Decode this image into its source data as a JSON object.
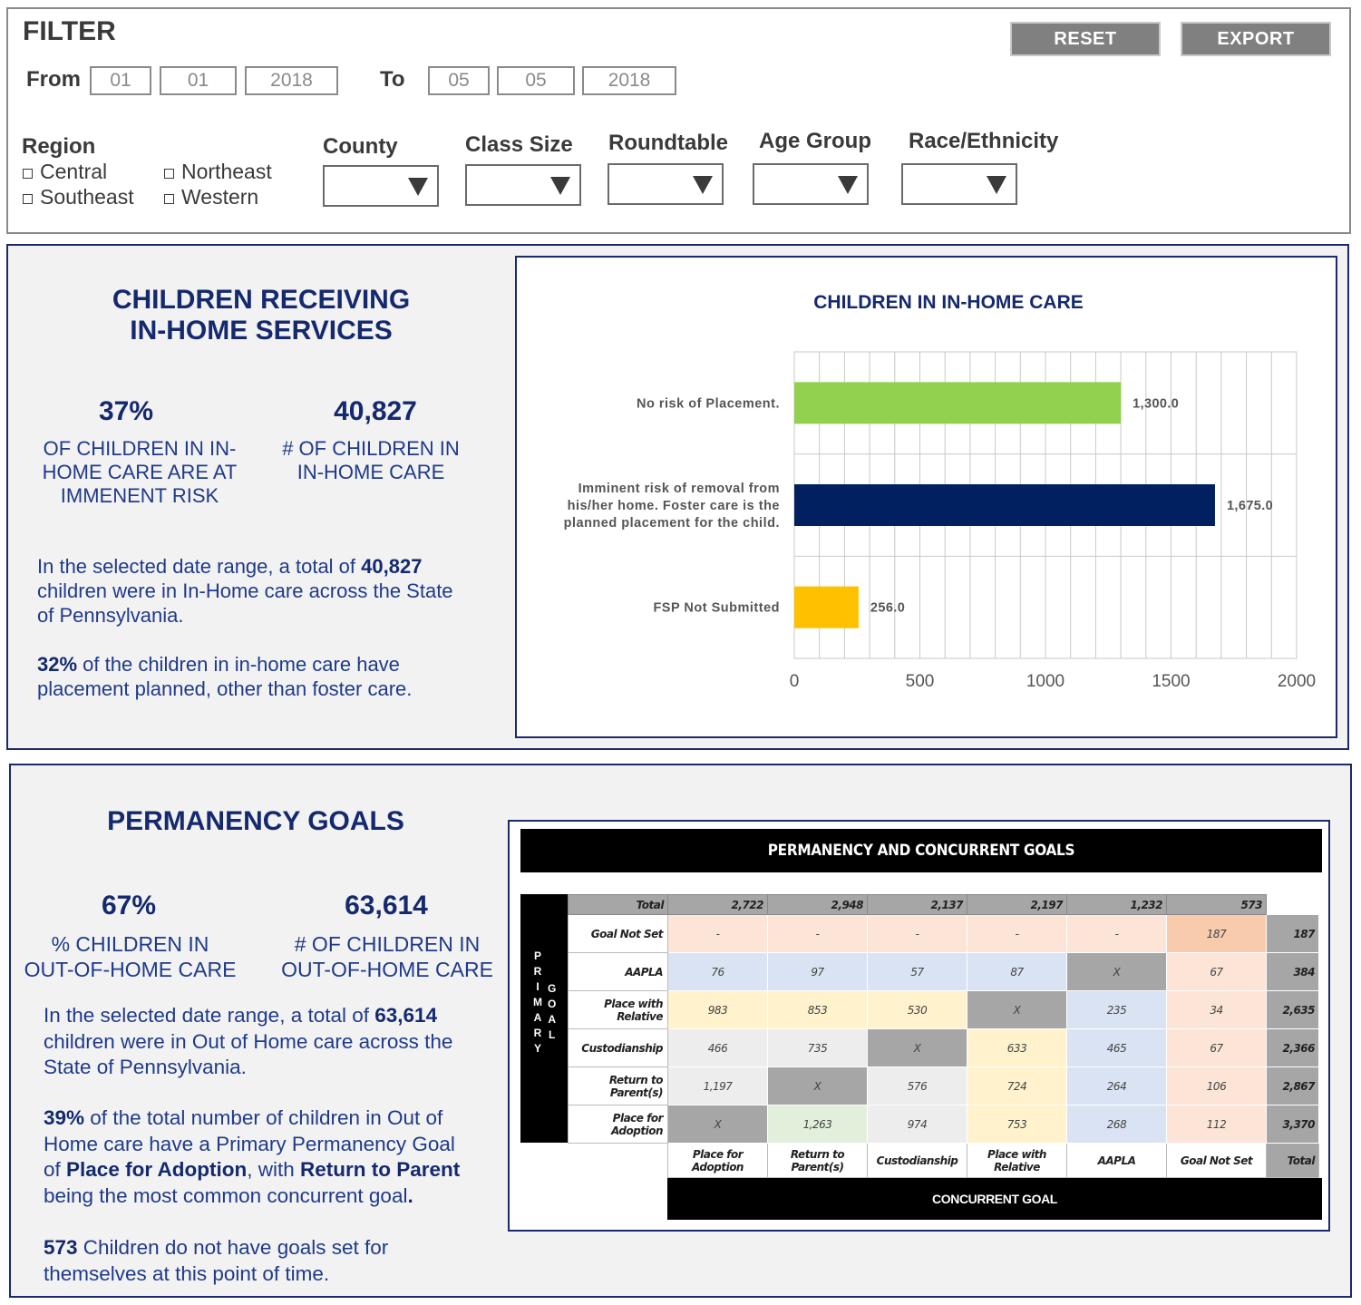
{
  "filter": {
    "title": "FILTER",
    "reset_label": "RESET",
    "export_label": "EXPORT",
    "from_label": "From",
    "from": {
      "month": "01",
      "day": "01",
      "year": "2018"
    },
    "to_label": "To",
    "to": {
      "month": "05",
      "day": "05",
      "year": "2018"
    },
    "region_label": "Region",
    "regions": [
      "Central",
      "Northeast",
      "Southeast",
      "Western"
    ],
    "dropdowns": {
      "county": "County",
      "class_size": "Class Size",
      "roundtable": "Roundtable",
      "age_group": "Age Group",
      "race": "Race/Ethnicity"
    },
    "dropdown_icon": "triangle-down-icon"
  },
  "inhome": {
    "title_line1": "CHILDREN RECEIVING",
    "title_line2": "IN-HOME SERVICES",
    "kpi1_value": "37%",
    "kpi1_l1": "OF CHILDREN IN IN-",
    "kpi1_l2": "HOME CARE ARE AT",
    "kpi1_l3": "IMMENENT RISK",
    "kpi2_value": "40,827",
    "kpi2_l1": "# OF CHILDREN IN",
    "kpi2_l2": "IN-HOME CARE",
    "p1_a": "In the selected date range, a total of ",
    "p1_b": "40,827",
    "p1_c": "children were in In-Home care across the State",
    "p1_d": "of Pennsylvania.",
    "p2_a": "32%",
    "p2_b": " of the children in in-home care have",
    "p2_c": "placement planned, other than foster care."
  },
  "chart_data": {
    "type": "bar",
    "orientation": "horizontal",
    "title": "CHILDREN IN IN-HOME CARE",
    "categories": [
      [
        "No risk of Placement."
      ],
      [
        "Imminent risk of removal from",
        "his/her home. Foster care is the",
        "planned placement for the child."
      ],
      [
        "FSP Not Submitted"
      ]
    ],
    "values": [
      1300.0,
      1675.0,
      256.0
    ],
    "value_labels": [
      "1,300.0",
      "1,675.0",
      "256.0"
    ],
    "colors": [
      "#92d050",
      "#002060",
      "#ffc000"
    ],
    "xlim": [
      0,
      2000
    ],
    "xticks": [
      0,
      500,
      1000,
      1500,
      2000
    ],
    "grid": true
  },
  "permanency": {
    "title": "PERMANENCY GOALS",
    "kpi1_value": "67%",
    "kpi1_l1": "% CHILDREN IN",
    "kpi1_l2": "OUT-OF-HOME CARE",
    "kpi2_value": "63,614",
    "kpi2_l1": "# OF CHILDREN IN",
    "kpi2_l2": "OUT-OF-HOME CARE",
    "p1_a": "In the selected date range, a total of ",
    "p1_b": "63,614",
    "p1_c": "children were in Out of Home care across the",
    "p1_d": "State of Pennsylvania.",
    "p2_a": "39%",
    "p2_b": " of the total number of children in Out of",
    "p2_c": "Home care have a Primary Permanency Goal",
    "p2_d": "of ",
    "p2_e": "Place for Adoption",
    "p2_f": ", with ",
    "p2_g": "Return to Parent",
    "p2_h": "being the most common concurrent goal",
    "p2_i": ".",
    "p3_a": "573",
    "p3_b": " Children do not have goals set for",
    "p3_c": "themselves at this point of time."
  },
  "goals_table": {
    "title": "PERMANENCY AND CONCURRENT GOALS",
    "primary_goal_letters": [
      "P",
      "R",
      "I",
      "M",
      "A",
      "R",
      "Y"
    ],
    "goal_letters": [
      "G",
      "O",
      "A",
      "L"
    ],
    "total_label": "Total",
    "col_totals": [
      "2,722",
      "2,948",
      "2,137",
      "2,197",
      "1,232",
      "573"
    ],
    "rows": [
      {
        "label": "Goal Not Set",
        "cells": [
          "-",
          "-",
          "-",
          "-",
          "-",
          "187"
        ],
        "total": "187"
      },
      {
        "label": "AAPLA",
        "cells": [
          "76",
          "97",
          "57",
          "87",
          "X",
          "67"
        ],
        "total": "384"
      },
      {
        "label": "Place with Relative",
        "cells": [
          "983",
          "853",
          "530",
          "X",
          "235",
          "34"
        ],
        "total": "2,635"
      },
      {
        "label": "Custodianship",
        "cells": [
          "466",
          "735",
          "X",
          "633",
          "465",
          "67"
        ],
        "total": "2,366"
      },
      {
        "label": "Return to Parent(s)",
        "cells": [
          "1,197",
          "X",
          "576",
          "724",
          "264",
          "106"
        ],
        "total": "2,867"
      },
      {
        "label": "Place for Adoption",
        "cells": [
          "X",
          "1,263",
          "974",
          "753",
          "268",
          "112"
        ],
        "total": "3,370"
      }
    ],
    "cell_colors": [
      [
        "#fce4d6",
        "#fce4d6",
        "#fce4d6",
        "#fce4d6",
        "#fce4d6",
        "#f8cbad"
      ],
      [
        "#dae3f3",
        "#dae3f3",
        "#dae3f3",
        "#dae3f3",
        "#a6a6a6",
        "#fce4d6"
      ],
      [
        "#fff2cc",
        "#fff2cc",
        "#fff2cc",
        "#a6a6a6",
        "#dae3f3",
        "#fce4d6"
      ],
      [
        "#ededed",
        "#ededed",
        "#a6a6a6",
        "#fff2cc",
        "#dae3f3",
        "#fce4d6"
      ],
      [
        "#ededed",
        "#a6a6a6",
        "#ededed",
        "#fff2cc",
        "#dae3f3",
        "#fce4d6"
      ],
      [
        "#a6a6a6",
        "#e2efda",
        "#ededed",
        "#fff2cc",
        "#dae3f3",
        "#fce4d6"
      ]
    ],
    "col_labels": [
      "Place for Adoption",
      "Return to Parent(s)",
      "Custodianship",
      "Place with Relative",
      "AAPLA",
      "Goal Not Set",
      "Total"
    ],
    "concurrent_label": "CONCURRENT GOAL"
  }
}
